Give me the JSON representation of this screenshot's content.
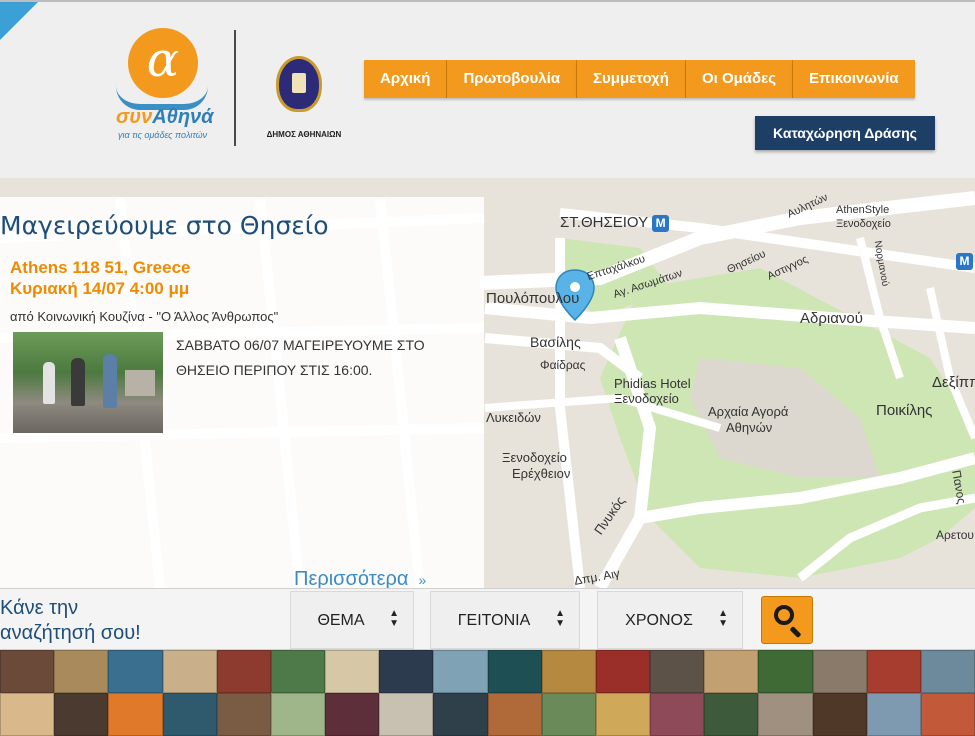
{
  "brand": {
    "logo_letter": "α",
    "logo_name_part1": "συν",
    "logo_name_part2": "Αθηνά",
    "tagline": "για τις ομάδες πολιτών",
    "municipality_label": "ΔΗΜΟΣ ΑΘΗΝΑΙΩΝ"
  },
  "nav": {
    "items": [
      {
        "label": "Αρχική"
      },
      {
        "label": "Πρωτοβουλία"
      },
      {
        "label": "Συμμετοχή"
      },
      {
        "label": "Οι Ομάδες"
      },
      {
        "label": "Επικοινωνία"
      }
    ],
    "register_button": "Καταχώρηση Δράσης"
  },
  "event": {
    "title": "Μαγειρεύουμε στο Θησείο",
    "location": "Athens 118 51, Greece",
    "date": "Κυριακή 14/07 4:00 μμ",
    "organizer": "από Κοινωνική Κουζίνα - \"Ο Άλλος Άνθρωπος\"",
    "description": "ΣΑΒΒΑΤΟ 06/07 ΜΑΓΕΙΡΕΥΟΥΜΕ ΣΤΟ ΘΗΣΕΙΟ ΠΕΡΙΠΟΥ ΣΤΙΣ 16:00.",
    "more_link": "Περισσότερα",
    "more_chevron": "»"
  },
  "map": {
    "labels": {
      "station": "ΣΤ.ΘΗΣΕΙΟΥ",
      "metro_badge": "M",
      "poulopoulou": "Πουλόπουλου",
      "vasilis": "Βασίλης",
      "faidras": "Φαίδρας",
      "eptachalkou": "Επταχάλκου",
      "ag_asomaton": "Αγ. Ασωμάτων",
      "theseiou": "Θησείου",
      "astiggos": "Αστιγγος",
      "adrianou": "Αδριανού",
      "deksippou": "Δεξίππ",
      "poikilis": "Ποικίλης",
      "hotel_phidias_1": "Phidias Hotel",
      "hotel_phidias_2": "Ξενοδοχείο",
      "agora_1": "Αρχαία Αγορά",
      "agora_2": "Αθηνών",
      "hotel_erechtheion_1": "Ξενοδοχείο",
      "hotel_erechtheion_2": "Ερέχθειον",
      "pnykos": "Πνυκός",
      "athenstyle_1": "AthenStyle",
      "athenstyle_2": "Ξενοδοχείο",
      "avlitou": "Αυλητών",
      "normanou": "Νορμανού",
      "pan": "Πανος",
      "aretou": "Αρετου",
      "lykeidon": "Λυκειδών",
      "apostolou": "Δπμ. Αιγ"
    }
  },
  "search": {
    "prompt_line1": "Κάνε την",
    "prompt_line2": "αναζήτησή σου!",
    "filters": [
      {
        "label": "ΘΕΜΑ"
      },
      {
        "label": "ΓΕΙΤΟΝΙΑ"
      },
      {
        "label": "ΧΡΟΝΟΣ"
      }
    ],
    "search_icon": "search-icon"
  },
  "colors": {
    "orange": "#f39a1e",
    "navy": "#1d3f66",
    "title_blue": "#1d4e7a",
    "link_blue": "#3b8cc6"
  }
}
